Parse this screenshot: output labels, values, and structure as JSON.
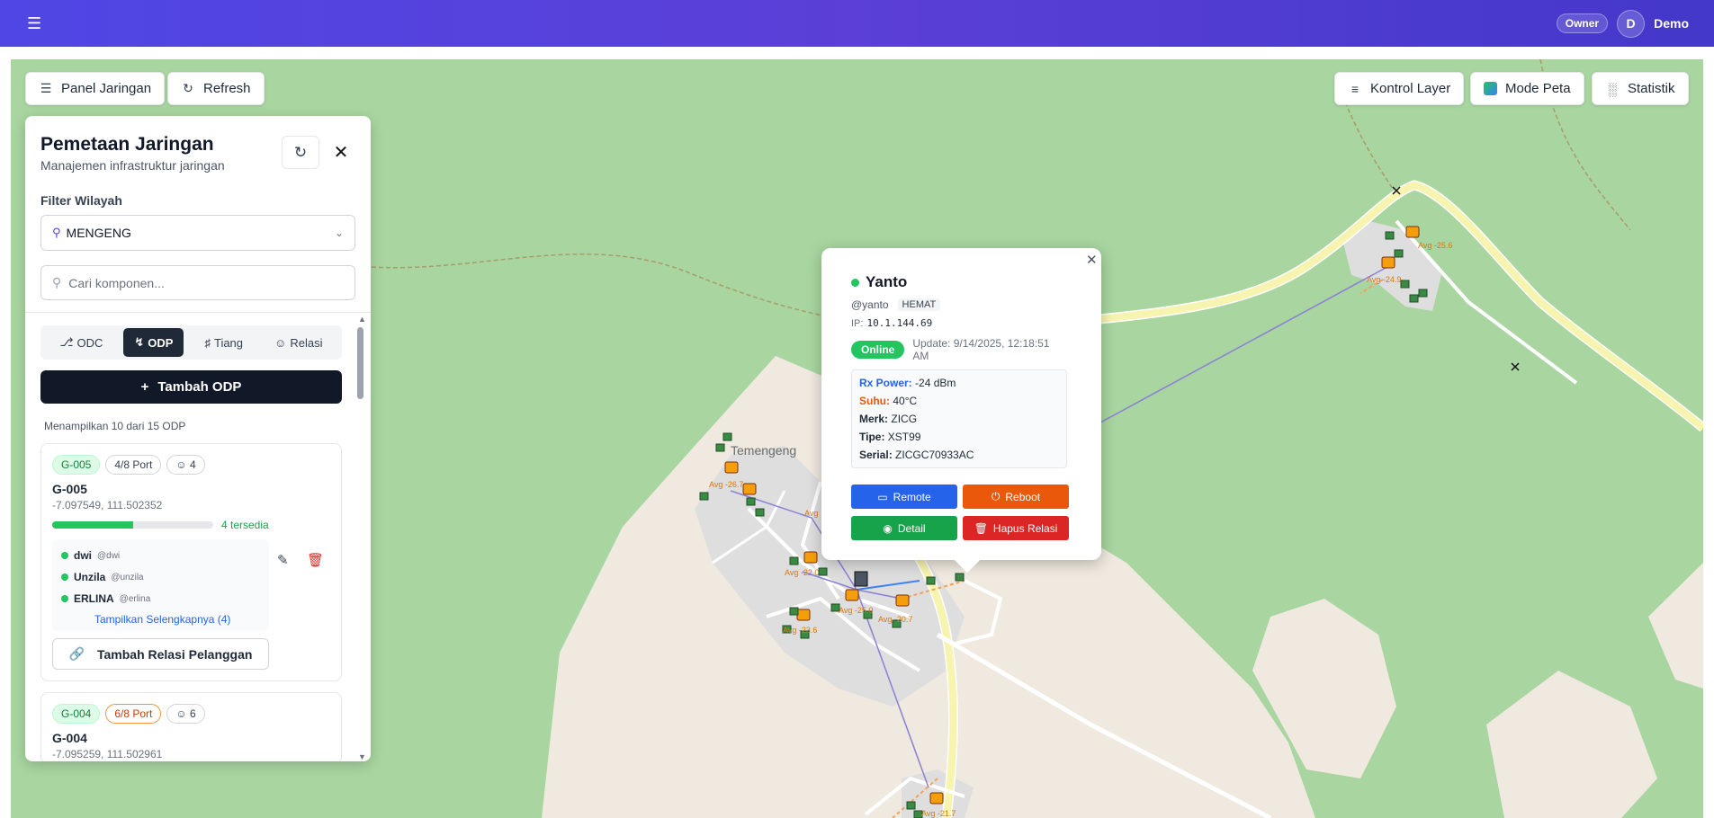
{
  "topbar": {
    "menu_icon": "hamburger-icon",
    "role_badge": "Owner",
    "avatar_initial": "D",
    "user_name": "Demo"
  },
  "map_controls": {
    "panel_button": "Panel Jaringan",
    "refresh_button": "Refresh",
    "layer_button": "Kontrol Layer",
    "mode_button": "Mode Peta",
    "stats_button": "Statistik"
  },
  "map_labels": {
    "village": "Temengeng",
    "marker_labels": [
      "Avg -25.6",
      "Avg -24.9",
      "Avg -26.7",
      "Avg",
      "Avg -22.0",
      "Avg -23.6",
      "Avg -20.7",
      "Avg -25.0",
      "Avg -21.7"
    ]
  },
  "panel": {
    "title": "Pemetaan Jaringan",
    "subtitle": "Manajemen infrastruktur jaringan",
    "filter_label": "Filter Wilayah",
    "filter_value": "MENGENG",
    "search_placeholder": "Cari komponen...",
    "tabs": [
      "ODC",
      "ODP",
      "Tiang",
      "Relasi"
    ],
    "active_tab": "ODP",
    "add_button": "Tambah ODP",
    "showing_text": "Menampilkan 10 dari 15 ODP",
    "cards": [
      {
        "code": "G-005",
        "ports": "4/8 Port",
        "customers": "4",
        "name": "G-005",
        "coords": "-7.097549, 111.502352",
        "usage": 0.5,
        "available": "4 tersedia",
        "customer_list": [
          {
            "name": "dwi",
            "handle": "@dwi"
          },
          {
            "name": "Unzila",
            "handle": "@unzila"
          },
          {
            "name": "ERLINA",
            "handle": "@erlina"
          }
        ],
        "more_link": "Tampilkan Selengkapnya (4)",
        "relation_button": "Tambah Relasi Pelanggan"
      },
      {
        "code": "G-004",
        "ports": "6/8 Port",
        "customers": "6",
        "name": "G-004",
        "coords": "-7.095259, 111.502961"
      }
    ]
  },
  "popup": {
    "name": "Yanto",
    "username": "@yanto",
    "package": "HEMAT",
    "ip_label": "IP:",
    "ip": "10.1.144.69",
    "status": "Online",
    "updated": "Update: 9/14/2025, 12:18:51 AM",
    "details": [
      {
        "label": "Rx Power:",
        "value": "-24 dBm"
      },
      {
        "label": "Suhu:",
        "value": "40°C"
      },
      {
        "label": "Merk:",
        "value": "ZICG"
      },
      {
        "label": "Tipe:",
        "value": "XST99"
      },
      {
        "label": "Serial:",
        "value": "ZICGC70933AC"
      }
    ],
    "buttons": {
      "remote": "Remote",
      "reboot": "Reboot",
      "detail": "Detail",
      "delete": "Hapus Relasi"
    }
  },
  "colors": {
    "header_start": "#4f46e5",
    "header_end": "#4338ca",
    "map_green": "#a8d5a0",
    "map_land": "#efe9df",
    "online": "#22c55e",
    "link_line": "#8b7fd6"
  }
}
